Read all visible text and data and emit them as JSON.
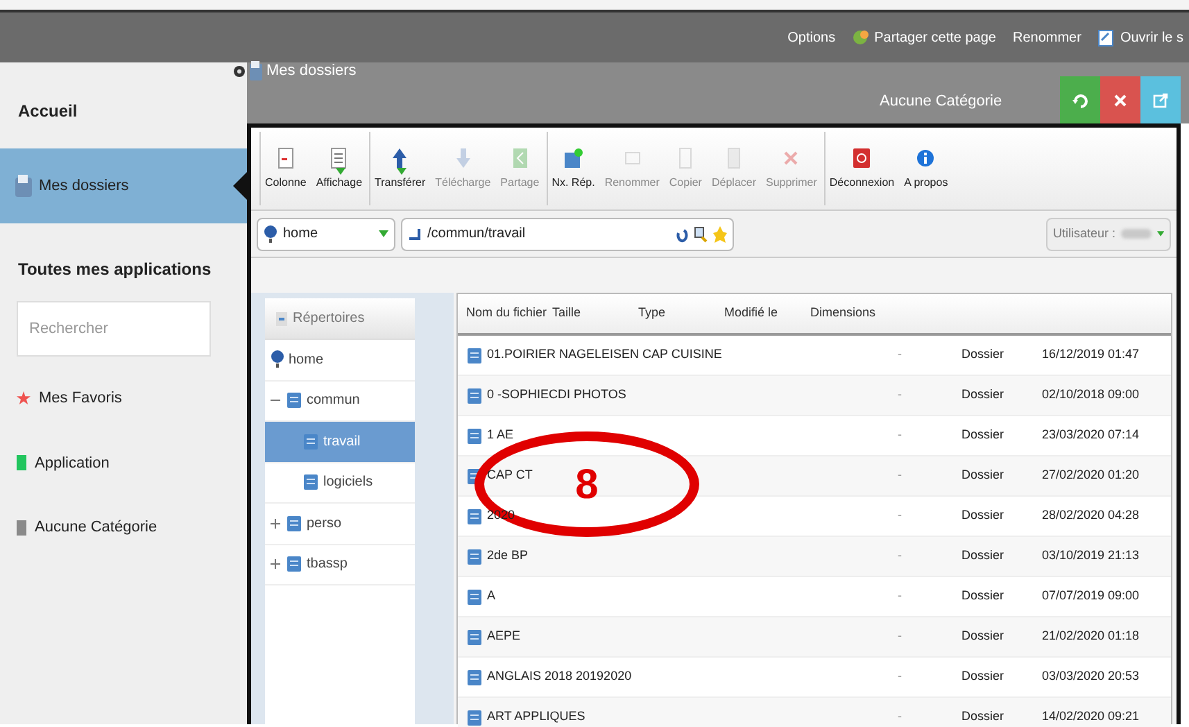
{
  "top_links": [
    {
      "label": "Options",
      "kind": "text"
    },
    {
      "label": "Partager cette page",
      "kind": "share"
    },
    {
      "label": "Renommer",
      "kind": "text"
    },
    {
      "label": "Ouvrir le s",
      "kind": "open"
    }
  ],
  "sidebar": {
    "home": "Accueil",
    "items": [
      {
        "label": "Mes dossiers",
        "selected": true
      }
    ],
    "section_title": "Toutes mes applications",
    "search": {
      "placeholder": "Rechercher"
    },
    "categories": [
      {
        "label": "Mes Favoris",
        "kind": "star",
        "color": "#ef5350"
      },
      {
        "label": "Application",
        "kind": "square",
        "color": "#22c55e"
      },
      {
        "label": "Aucune Catégorie",
        "kind": "square",
        "color": "#8a8a8a"
      }
    ]
  },
  "panel": {
    "title": "Mes dossiers",
    "category": "Aucune Catégorie",
    "buttons": [
      {
        "kind": "refresh",
        "color": "#4cae4c"
      },
      {
        "kind": "close",
        "color": "#d9534f"
      },
      {
        "kind": "external",
        "color": "#5bc0de"
      }
    ]
  },
  "toolbar": [
    {
      "label": "Colonne",
      "kind": "column",
      "disabled": false,
      "dropdown": false,
      "group_start": true
    },
    {
      "label": "Affichage",
      "kind": "list",
      "disabled": false,
      "dropdown": true,
      "group_start": false
    },
    {
      "label": "Transférer",
      "kind": "upload",
      "disabled": false,
      "dropdown": true,
      "group_start": true
    },
    {
      "label": "Télécharge",
      "kind": "download",
      "disabled": true,
      "dropdown": false,
      "group_start": false
    },
    {
      "label": "Partage",
      "kind": "share",
      "disabled": true,
      "dropdown": false,
      "group_start": false
    },
    {
      "label": "Nx. Rép.",
      "kind": "newfolder",
      "disabled": false,
      "dropdown": false,
      "group_start": true
    },
    {
      "label": "Renommer",
      "kind": "rename",
      "disabled": true,
      "dropdown": false,
      "group_start": false
    },
    {
      "label": "Copier",
      "kind": "copy",
      "disabled": true,
      "dropdown": false,
      "group_start": false
    },
    {
      "label": "Déplacer",
      "kind": "move",
      "disabled": true,
      "dropdown": false,
      "group_start": false
    },
    {
      "label": "Supprimer",
      "kind": "delete",
      "disabled": true,
      "dropdown": false,
      "group_start": false
    },
    {
      "label": "Déconnexion",
      "kind": "power",
      "disabled": false,
      "dropdown": false,
      "group_start": true
    },
    {
      "label": "A propos",
      "kind": "info",
      "disabled": false,
      "dropdown": false,
      "group_start": false
    }
  ],
  "location": {
    "root": "home",
    "path": "/commun/travail",
    "user_label": "Utilisateur :"
  },
  "tree": {
    "title": "Répertoires",
    "items": [
      {
        "label": "home",
        "selected": false,
        "children": [
          {
            "label": "commun",
            "selected": false,
            "expanded": true,
            "children": [
              {
                "label": "travail",
                "selected": true
              },
              {
                "label": "logiciels",
                "selected": false
              }
            ]
          },
          {
            "label": "perso",
            "selected": false,
            "expanded": false
          },
          {
            "label": "tbassp",
            "selected": false,
            "expanded": false
          }
        ]
      }
    ]
  },
  "table": {
    "columns": [
      "Nom du fichier",
      "Taille",
      "Type",
      "Modifié le",
      "Dimensions"
    ],
    "rows": [
      {
        "name": "01.POIRIER NAGELEISEN CAP CUISINE",
        "size": "-",
        "type": "Dossier",
        "modified": "16/12/2019 01:47"
      },
      {
        "name": "0 -SOPHIECDI PHOTOS",
        "size": "-",
        "type": "Dossier",
        "modified": "02/10/2018 09:00"
      },
      {
        "name": "1 AE",
        "size": "-",
        "type": "Dossier",
        "modified": "23/03/2020 07:14"
      },
      {
        "name": "CAP CT",
        "size": "-",
        "type": "Dossier",
        "modified": "27/02/2020 01:20"
      },
      {
        "name": "2020",
        "size": "-",
        "type": "Dossier",
        "modified": "28/02/2020 04:28"
      },
      {
        "name": "2de BP",
        "size": "-",
        "type": "Dossier",
        "modified": "03/10/2019 21:13"
      },
      {
        "name": "A",
        "size": "-",
        "type": "Dossier",
        "modified": "07/07/2019 09:00"
      },
      {
        "name": "AEPE",
        "size": "-",
        "type": "Dossier",
        "modified": "21/02/2020 01:18"
      },
      {
        "name": "ANGLAIS 2018 20192020",
        "size": "-",
        "type": "Dossier",
        "modified": "03/03/2020 20:53"
      },
      {
        "name": "ART APPLIQUES",
        "size": "-",
        "type": "Dossier",
        "modified": "14/02/2020 09:21"
      }
    ]
  },
  "annotation": {
    "label": "8"
  }
}
